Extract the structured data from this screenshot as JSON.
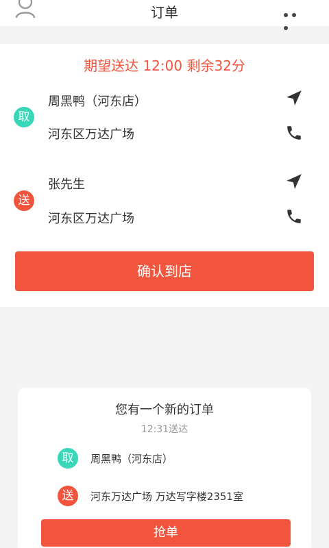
{
  "header": {
    "title": "订单",
    "left_icon": "user-icon",
    "right_icon": "more-icon"
  },
  "order": {
    "expect_text": "期望送达 12:00 剩余32分",
    "pickup": {
      "badge": "取",
      "name": "周黑鸭（河东店）",
      "address": "河东区万达广场"
    },
    "delivery": {
      "badge": "送",
      "name": "张先生",
      "address": "河东区万达广场"
    },
    "confirm_label": "确认到店"
  },
  "new_order": {
    "title": "您有一个新的订单",
    "time_text": "12:31送达",
    "pickup": {
      "badge": "取",
      "text": "周黑鸭（河东店）"
    },
    "delivery": {
      "badge": "送",
      "text": "河东万达广场 万达写字楼2351室"
    },
    "grab_label": "抢单"
  },
  "colors": {
    "accent": "#f2553e",
    "pickup_badge": "#37d7b8"
  }
}
